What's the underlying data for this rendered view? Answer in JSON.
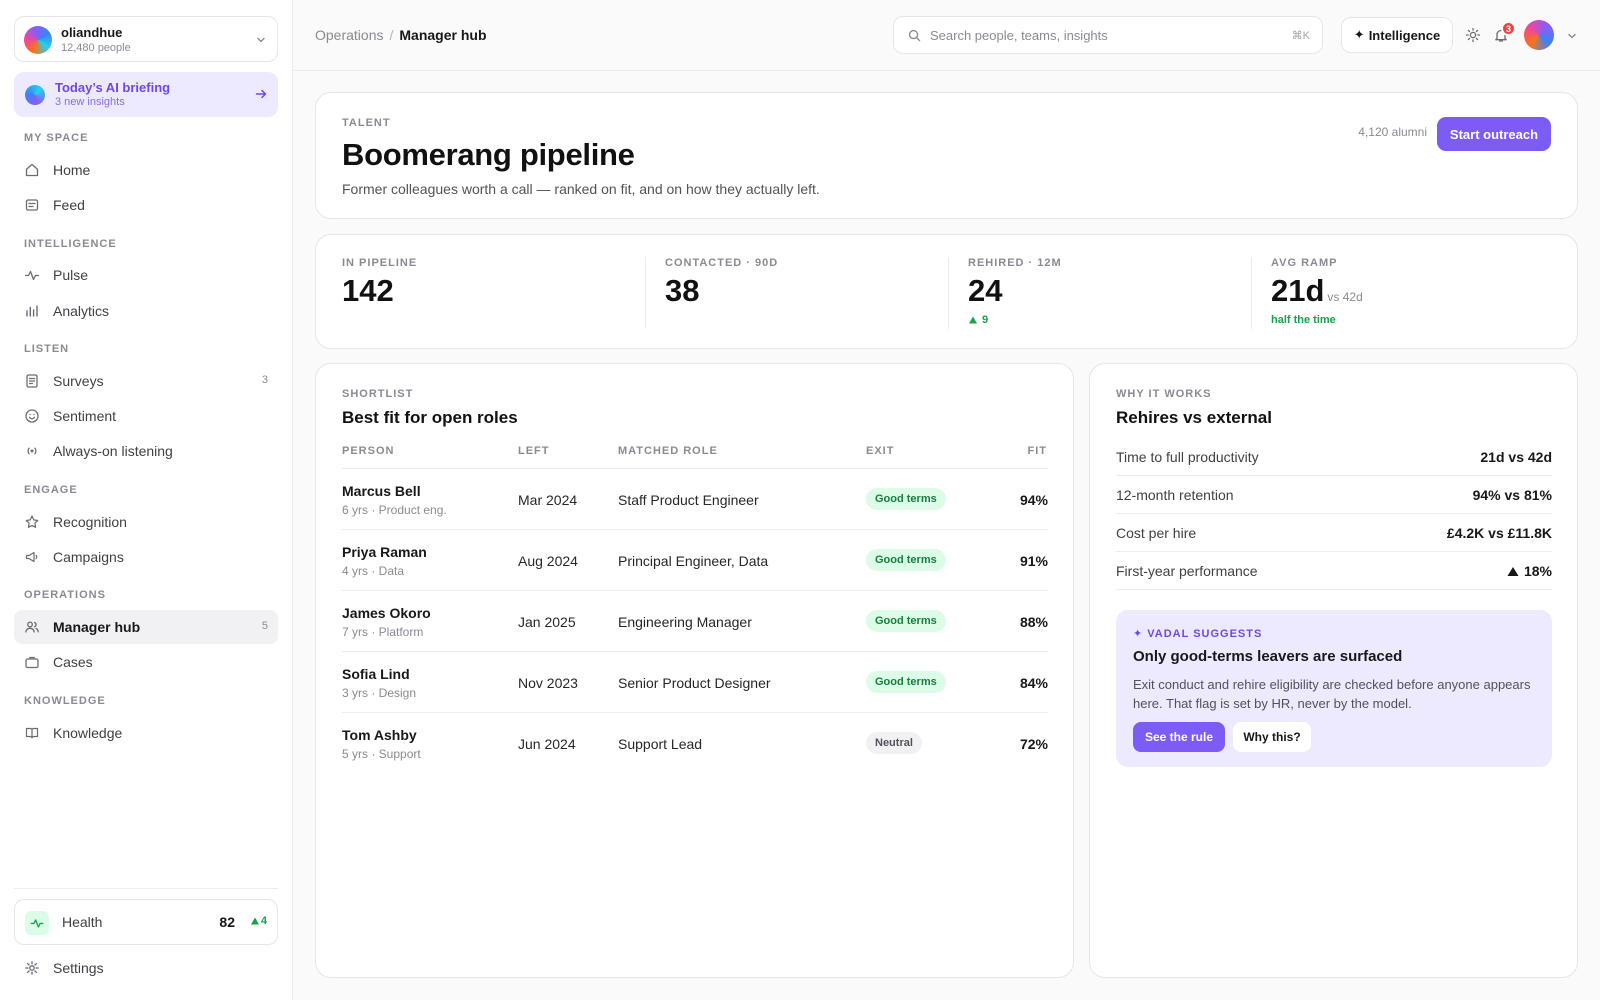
{
  "org": {
    "name": "oliandhue",
    "sub": "12,480 people"
  },
  "briefing": {
    "title": "Today’s AI briefing",
    "sub": "3 new insights"
  },
  "sidebar": {
    "sections": [
      "MY SPACE",
      "INTELLIGENCE",
      "LISTEN",
      "ENGAGE",
      "OPERATIONS",
      "KNOWLEDGE"
    ],
    "items": [
      {
        "label": "Home",
        "icon": "home-icon"
      },
      {
        "label": "Feed",
        "icon": "feed-icon"
      },
      {
        "label": "Pulse",
        "icon": "pulse-icon"
      },
      {
        "label": "Analytics",
        "icon": "analytics-icon"
      },
      {
        "label": "Surveys",
        "icon": "survey-icon",
        "count": "3"
      },
      {
        "label": "Sentiment",
        "icon": "smile-icon"
      },
      {
        "label": "Always-on listening",
        "icon": "broadcast-icon"
      },
      {
        "label": "Recognition",
        "icon": "star-icon"
      },
      {
        "label": "Campaigns",
        "icon": "megaphone-icon"
      },
      {
        "label": "Manager hub",
        "icon": "people-icon",
        "count": "5",
        "active": true
      },
      {
        "label": "Cases",
        "icon": "briefcase-icon"
      },
      {
        "label": "Knowledge",
        "icon": "book-icon"
      }
    ],
    "health": {
      "label": "Health",
      "value": "82",
      "delta": "4"
    },
    "settings": "Settings"
  },
  "topbar": {
    "breadcrumb": [
      "Operations",
      "Manager hub"
    ],
    "search_placeholder": "Search people, teams, insights",
    "search_shortcut": "⌘K",
    "intelligence_label": "Intelligence",
    "notifications": "3"
  },
  "hero": {
    "eyebrow": "TALENT",
    "title": "Boomerang pipeline",
    "subtitle": "Former colleagues worth a call — ranked on fit, and on how they actually left.",
    "alumni": "4,120 alumni",
    "cta": "Start outreach"
  },
  "kpis": [
    {
      "label": "IN PIPELINE",
      "value": "142"
    },
    {
      "label": "CONTACTED · 90D",
      "value": "38"
    },
    {
      "label": "REHIRED · 12M",
      "value": "24",
      "note": "9"
    },
    {
      "label": "AVG RAMP",
      "value": "21d",
      "vs": "vs 42d",
      "note": "half the time"
    }
  ],
  "shortlist": {
    "eyebrow": "SHORTLIST",
    "title": "Best fit for open roles",
    "columns": [
      "PERSON",
      "LEFT",
      "MATCHED ROLE",
      "EXIT",
      "FIT"
    ],
    "rows": [
      {
        "name": "Marcus Bell",
        "meta": "6 yrs · Product eng.",
        "left": "Mar 2024",
        "role": "Staff Product Engineer",
        "exit": "Good terms",
        "fit": "94%"
      },
      {
        "name": "Priya Raman",
        "meta": "4 yrs · Data",
        "left": "Aug 2024",
        "role": "Principal Engineer, Data",
        "exit": "Good terms",
        "fit": "91%"
      },
      {
        "name": "James Okoro",
        "meta": "7 yrs · Platform",
        "left": "Jan 2025",
        "role": "Engineering Manager",
        "exit": "Good terms",
        "fit": "88%"
      },
      {
        "name": "Sofia Lind",
        "meta": "3 yrs · Design",
        "left": "Nov 2023",
        "role": "Senior Product Designer",
        "exit": "Good terms",
        "fit": "84%"
      },
      {
        "name": "Tom Ashby",
        "meta": "5 yrs · Support",
        "left": "Jun 2024",
        "role": "Support Lead",
        "exit": "Neutral",
        "fit": "72%"
      }
    ]
  },
  "why": {
    "eyebrow": "WHY IT WORKS",
    "title": "Rehires vs external",
    "rows": [
      {
        "label": "Time to full productivity",
        "value": "21d vs 42d"
      },
      {
        "label": "12-month retention",
        "value": "94% vs 81%"
      },
      {
        "label": "Cost per hire",
        "value": "£4.2K vs £11.8K"
      },
      {
        "label": "First-year performance",
        "value": "18%",
        "up": true
      }
    ],
    "suggest": {
      "eyebrow": "✦ VADAL SUGGESTS",
      "title": "Only good-terms leavers are surfaced",
      "body": "Exit conduct and rehire eligibility are checked before anyone appears here. That flag is set by HR, never by the model.",
      "primary": "See the rule",
      "secondary": "Why this?"
    }
  },
  "colors": {
    "accent": "#7c5cf4",
    "success": "#16a34a",
    "danger": "#ef4444"
  }
}
